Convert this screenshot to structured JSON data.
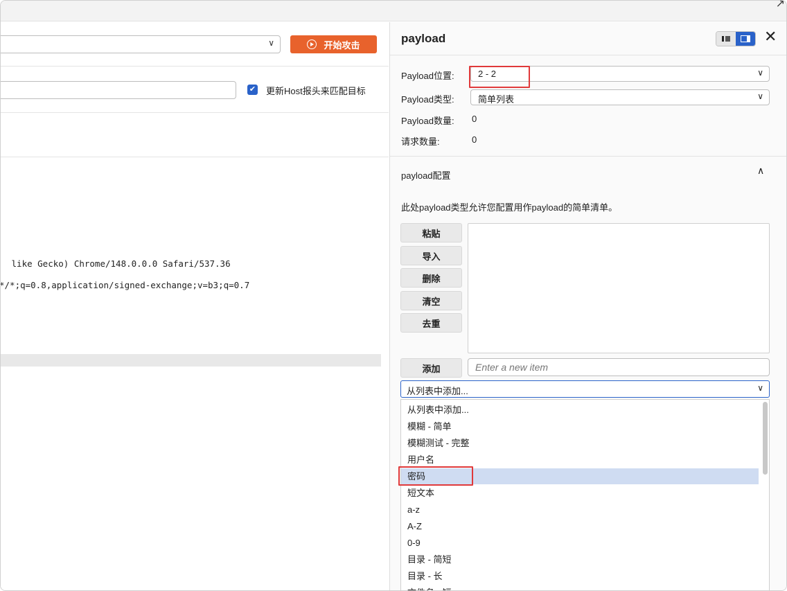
{
  "left": {
    "start_attack_label": "开始攻击",
    "update_host_label": "更新Host报头来匹配目标",
    "update_host_checked": true,
    "request_lines": [
      " like Gecko) Chrome/148.0.0.0 Safari/537.36",
      "*/*;q=0.8,application/signed-exchange;v=b3;q=0.7"
    ]
  },
  "panel": {
    "title": "payload",
    "position_label": "Payload位置:",
    "position_value": "2 - 2",
    "type_label": "Payload类型:",
    "type_value": "简单列表",
    "count_label": "Payload数量:",
    "count_value": "0",
    "requests_label": "请求数量:",
    "requests_value": "0",
    "config_title": "payload配置",
    "config_desc": "此处payload类型允许您配置用作payload的简单清单。",
    "buttons": [
      "粘贴",
      "导入",
      "删除",
      "清空",
      "去重"
    ],
    "add_label": "添加",
    "new_item_placeholder": "Enter a new item",
    "from_list_value": "从列表中添加...",
    "dropdown_items": [
      "从列表中添加...",
      "模糊 - 简单",
      "模糊测试 - 完整",
      "用户名",
      "密码",
      "短文本",
      "a-z",
      "A-Z",
      "0-9",
      "目录 - 简短",
      "目录 - 长",
      "文件名 - 短"
    ],
    "selected_index": 4
  }
}
